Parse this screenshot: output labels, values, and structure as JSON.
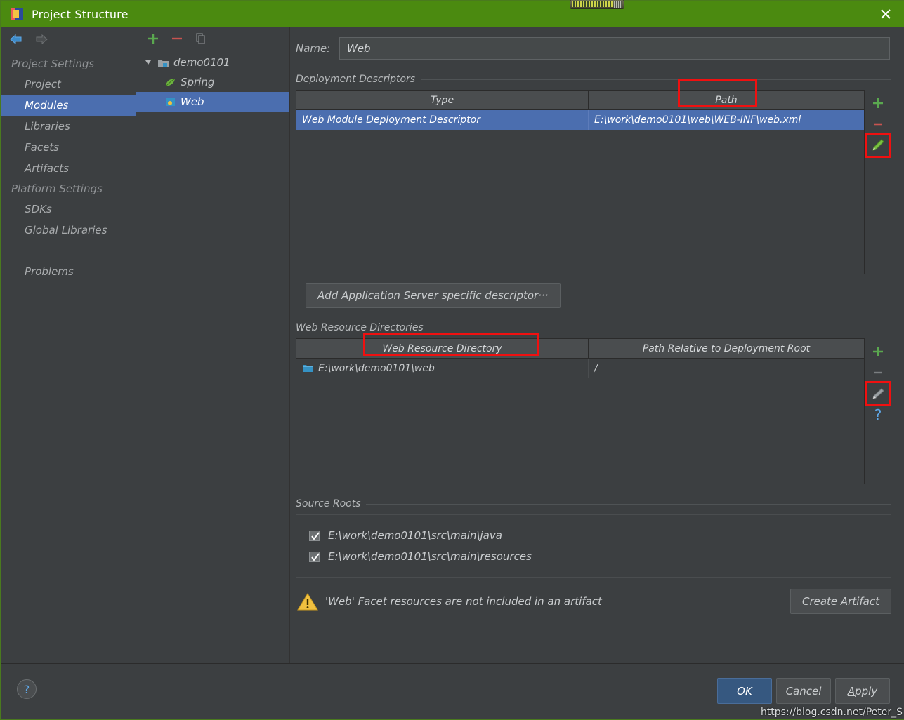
{
  "window": {
    "title": "Project Structure",
    "title_bar_color": "#4b8a10",
    "close_icon": "close-icon",
    "app_icon": "intellij-idea-icon"
  },
  "navigation": {
    "back_icon": "arrow-left-icon",
    "forward_icon": "arrow-right-icon"
  },
  "sidebar": {
    "groups": [
      {
        "label": "Project Settings",
        "items": [
          {
            "label": "Project",
            "selected": false
          },
          {
            "label": "Modules",
            "selected": true
          },
          {
            "label": "Libraries",
            "selected": false
          },
          {
            "label": "Facets",
            "selected": false
          },
          {
            "label": "Artifacts",
            "selected": false
          }
        ]
      },
      {
        "label": "Platform Settings",
        "items": [
          {
            "label": "SDKs",
            "selected": false
          },
          {
            "label": "Global Libraries",
            "selected": false
          }
        ]
      }
    ],
    "problems_label": "Problems"
  },
  "tree_panel": {
    "toolbar": [
      {
        "icon": "plus-icon",
        "color": "#5aa84f"
      },
      {
        "icon": "minus-icon",
        "color": "#c75450"
      },
      {
        "icon": "copy-icon",
        "color": "#7a7e80"
      }
    ],
    "nodes": [
      {
        "label": "demo0101",
        "icon": "module-folder-icon",
        "level": 1,
        "expanded": true,
        "selected": false
      },
      {
        "label": "Spring",
        "icon": "spring-leaf-icon",
        "level": 2,
        "selected": false
      },
      {
        "label": "Web",
        "icon": "web-facet-icon",
        "level": 2,
        "selected": true
      }
    ]
  },
  "main": {
    "name_label": "Name:",
    "name_value": "Web",
    "name_placeholder": "",
    "deployment_descriptors": {
      "section_label": "Deployment Descriptors",
      "columns": [
        "Type",
        "Path"
      ],
      "rows": [
        {
          "type": "Web Module Deployment Descriptor",
          "path": "E:\\work\\demo0101\\web\\WEB-INF\\web.xml",
          "selected": true
        }
      ],
      "actions": [
        {
          "icon": "plus-icon",
          "label": "Add",
          "color": "#5aa84f",
          "highlighted": false
        },
        {
          "icon": "minus-icon",
          "label": "Remove",
          "color": "#c75450",
          "highlighted": false
        },
        {
          "icon": "pencil-edit-icon",
          "label": "Edit",
          "color": "#7ac143",
          "highlighted": true
        }
      ],
      "add_app_server_button": "Add Application Server specific descriptor···",
      "add_app_server_mnemonic": "S"
    },
    "web_resource_directories": {
      "section_label": "Web Resource Directories",
      "columns": [
        "Web Resource Directory",
        "Path Relative to Deployment Root"
      ],
      "column_highlighted": "Web Resource Directory",
      "rows": [
        {
          "directory": "E:\\work\\demo0101\\web",
          "relative_path": "/",
          "icon": "folder-icon"
        }
      ],
      "actions": [
        {
          "icon": "plus-icon",
          "label": "Add",
          "color": "#5aa84f",
          "highlighted": false
        },
        {
          "icon": "minus-icon",
          "label": "Remove",
          "color": "#7a7e80",
          "highlighted": false
        },
        {
          "icon": "pencil-edit-icon",
          "label": "Edit",
          "color": "#9aa0a4",
          "highlighted": true
        },
        {
          "icon": "question-help-icon",
          "label": "Help",
          "color": "#5fa8e8",
          "highlighted": false
        }
      ]
    },
    "source_roots": {
      "section_label": "Source Roots",
      "items": [
        {
          "label": "E:\\work\\demo0101\\src\\main\\java",
          "checked": true
        },
        {
          "label": "E:\\work\\demo0101\\src\\main\\resources",
          "checked": true
        }
      ]
    },
    "warning": {
      "icon": "warning-triangle-icon",
      "text": "'Web' Facet resources are not included in an artifact",
      "action_button": "Create Artifact",
      "action_mnemonic": "f"
    }
  },
  "footer": {
    "help_label": "?",
    "buttons": [
      {
        "label": "OK",
        "primary": true,
        "mnemonic": ""
      },
      {
        "label": "Cancel",
        "primary": false,
        "mnemonic": ""
      },
      {
        "label": "Apply",
        "primary": false,
        "mnemonic": "A"
      }
    ]
  },
  "watermark": "https://blog.csdn.net/Peter_S",
  "colors": {
    "title_green": "#4b8a10",
    "selection_blue": "#4b6eaf",
    "primary_button": "#365880",
    "background": "#3c3f41",
    "highlight_red": "#f01010",
    "accent_green": "#5aa84f",
    "warning_yellow": "#f0c040"
  }
}
